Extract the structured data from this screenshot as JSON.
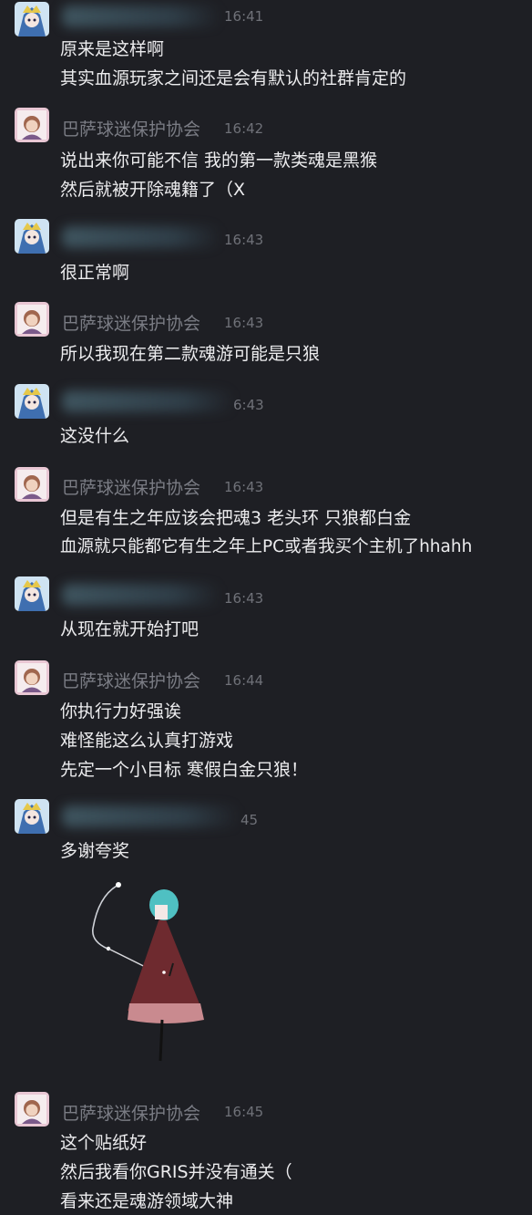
{
  "messages": [
    {
      "sender": "",
      "time": "16:41",
      "lines": [
        "原来是这样啊",
        "其实血源玩家之间还是会有默认的社群肯定的"
      ]
    },
    {
      "sender": "巴萨球迷保护协会",
      "time": "16:42",
      "lines": [
        "说出来你可能不信 我的第一款类魂是黑猴",
        "然后就被开除魂籍了（X"
      ]
    },
    {
      "sender": "",
      "time": "16:43",
      "lines": [
        "很正常啊"
      ]
    },
    {
      "sender": "巴萨球迷保护协会",
      "time": "16:43",
      "lines": [
        "所以我现在第二款魂游可能是只狼"
      ]
    },
    {
      "sender": "",
      "time": "6:43",
      "lines": [
        "这没什么"
      ]
    },
    {
      "sender": "巴萨球迷保护协会",
      "time": "16:43",
      "lines": [
        "但是有生之年应该会把魂3 老头环 只狼都白金",
        "血源就只能都它有生之年上PC或者我买个主机了hhahh"
      ]
    },
    {
      "sender": "",
      "time": "16:43",
      "lines": [
        "从现在就开始打吧"
      ]
    },
    {
      "sender": "巴萨球迷保护协会",
      "time": "16:44",
      "lines": [
        "你执行力好强诶",
        "难怪能这么认真打游戏",
        "先定一个小目标 寒假白金只狼！"
      ]
    },
    {
      "sender": "",
      "time": "45",
      "lines": [
        "多谢夸奖"
      ]
    },
    {
      "sender": "巴萨球迷保护协会",
      "time": "16:45",
      "lines": [
        "这个贴纸好",
        "然后我看你GRIS并没有通关（",
        "看来还是魂游领域大神"
      ]
    }
  ],
  "colors": {
    "background": "#1e1f24",
    "sender_name": "#7a7c84",
    "timestamp": "#6f7178",
    "message_text": "#ececee"
  }
}
